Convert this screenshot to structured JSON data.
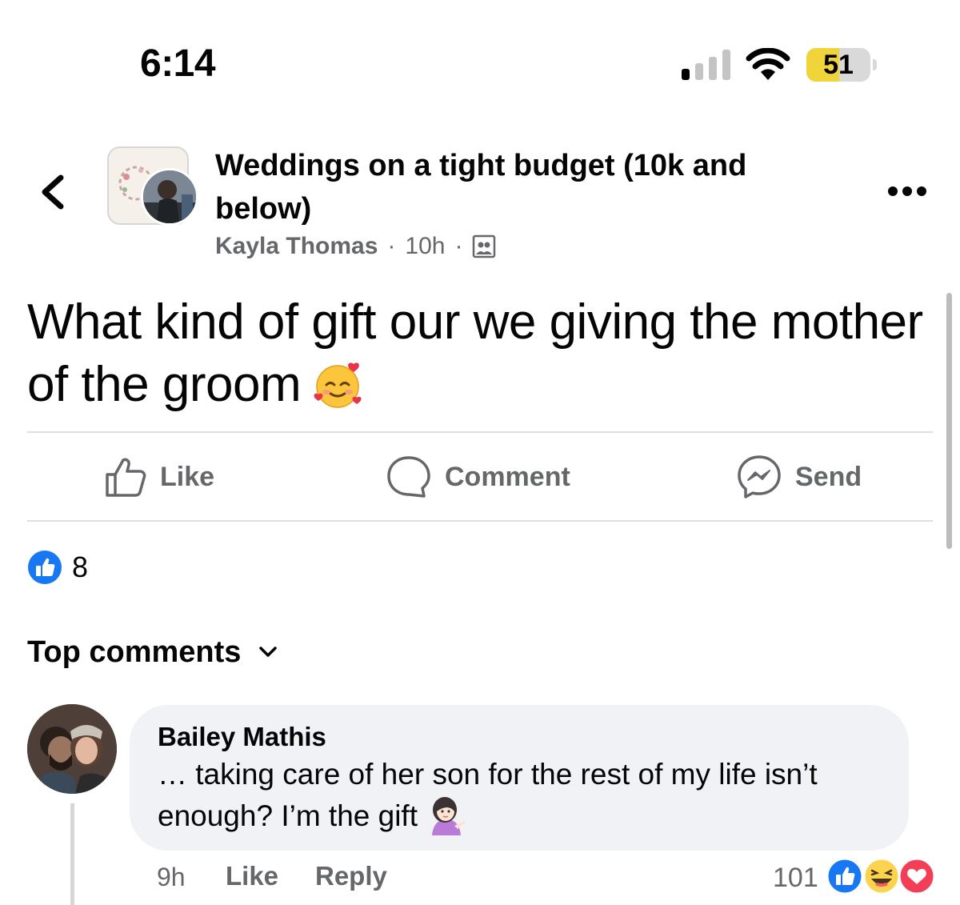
{
  "status_bar": {
    "time": "6:14",
    "battery": "51",
    "battery_fraction": 0.51
  },
  "header": {
    "group_name": "Weddings on a tight budget (10k and below)",
    "author": "Kayla Thomas",
    "separator": "·",
    "time_ago": "10h",
    "privacy_icon": "members-only-icon"
  },
  "post": {
    "text": "What kind of gift our we giving the mother of the groom",
    "emoji": "smiling-face-with-hearts"
  },
  "actions": {
    "like": "Like",
    "comment": "Comment",
    "send": "Send"
  },
  "reactions": {
    "count": "8",
    "type": "like"
  },
  "comments_section": {
    "sort_label": "Top comments"
  },
  "comment": {
    "author": "Bailey Mathis",
    "text": "… taking care of her son for the rest of my life isn’t enough? I’m the gift",
    "emoji": "person-tipping-hand",
    "time": "9h",
    "like_label": "Like",
    "reply_label": "Reply",
    "reaction_count": "101",
    "reaction_types": [
      "like",
      "haha",
      "love"
    ]
  },
  "colors": {
    "facebook_blue": "#1877F2",
    "secondary_text": "#65676B",
    "bubble_bg": "#F0F2F5",
    "battery_yellow": "#F1D33A",
    "love_red": "#F33E58"
  }
}
